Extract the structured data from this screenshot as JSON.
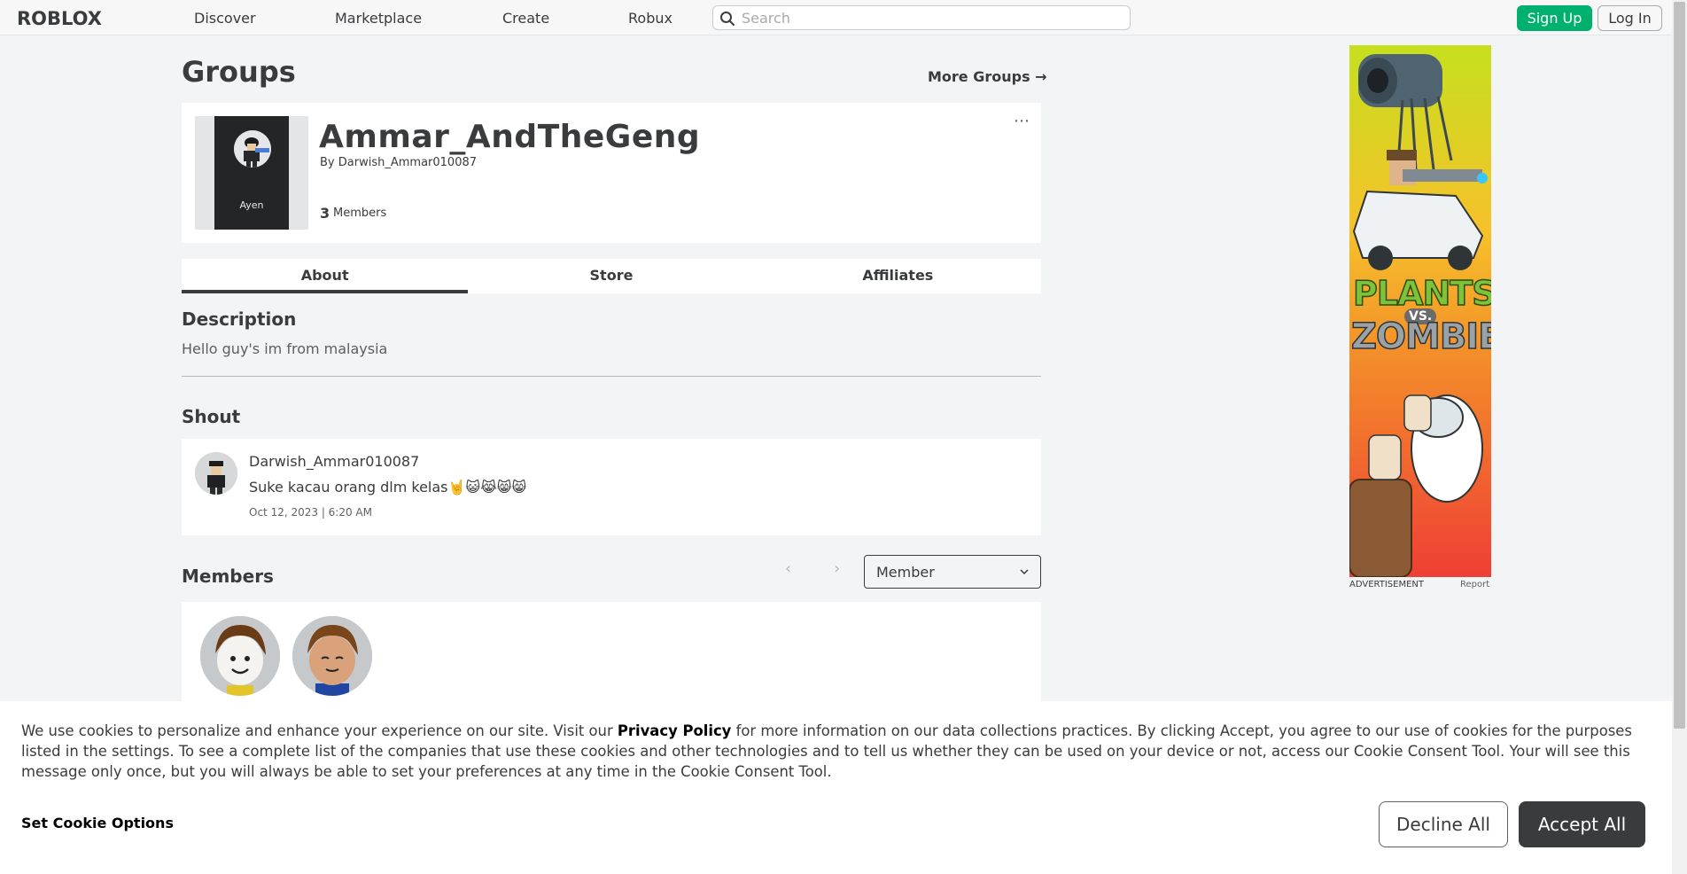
{
  "nav": {
    "logo": "ROBLOX",
    "links": [
      "Discover",
      "Marketplace",
      "Create",
      "Robux"
    ],
    "search_placeholder": "Search",
    "signup_label": "Sign Up",
    "login_label": "Log In"
  },
  "page": {
    "title": "Groups",
    "more_groups_label": "More Groups →"
  },
  "group": {
    "name": "Ammar_AndTheGeng",
    "owner_prefix": "By",
    "owner": "Darwish_Ammar010087",
    "member_count": "3",
    "member_count_label": "Members",
    "emblem_label": "Ayen",
    "more_menu": "⋯"
  },
  "tabs": [
    {
      "label": "About",
      "active": true
    },
    {
      "label": "Store",
      "active": false
    },
    {
      "label": "Affiliates",
      "active": false
    }
  ],
  "about": {
    "description_title": "Description",
    "description_text": "Hello guy's im from malaysia",
    "shout_title": "Shout",
    "shout": {
      "author": "Darwish_Ammar010087",
      "text": "Suke kacau orang dlm kelas🤘😺😹😸😸",
      "date": "Oct 12, 2023 | 6:20 AM"
    },
    "members_title": "Members",
    "role_select_value": "Member"
  },
  "ad": {
    "label": "ADVERTISEMENT",
    "report_label": "Report",
    "title_line_1": "PLANTS",
    "title_vs": "VS.",
    "title_line_2": "ZOMBIES"
  },
  "cookie": {
    "text_before": "We use cookies to personalize and enhance your experience on our site. Visit our ",
    "privacy_link": "Privacy Policy",
    "text_after": " for more information on our data collections practices. By clicking Accept, you agree to our use of cookies for the purposes listed in the settings. To see a complete list of the companies that use these cookies and other technologies and to tell us whether they can be used on your device or not, access our Cookie Consent Tool. Your will see this message only once, but you will always be able to set your preferences at any time in the Cookie Consent Tool.",
    "options_label": "Set Cookie Options",
    "decline_label": "Decline All",
    "accept_label": "Accept All"
  },
  "colors": {
    "signup_green": "#00b06f",
    "accept_dark": "#393b3d",
    "page_bg": "#f2f4f5"
  }
}
